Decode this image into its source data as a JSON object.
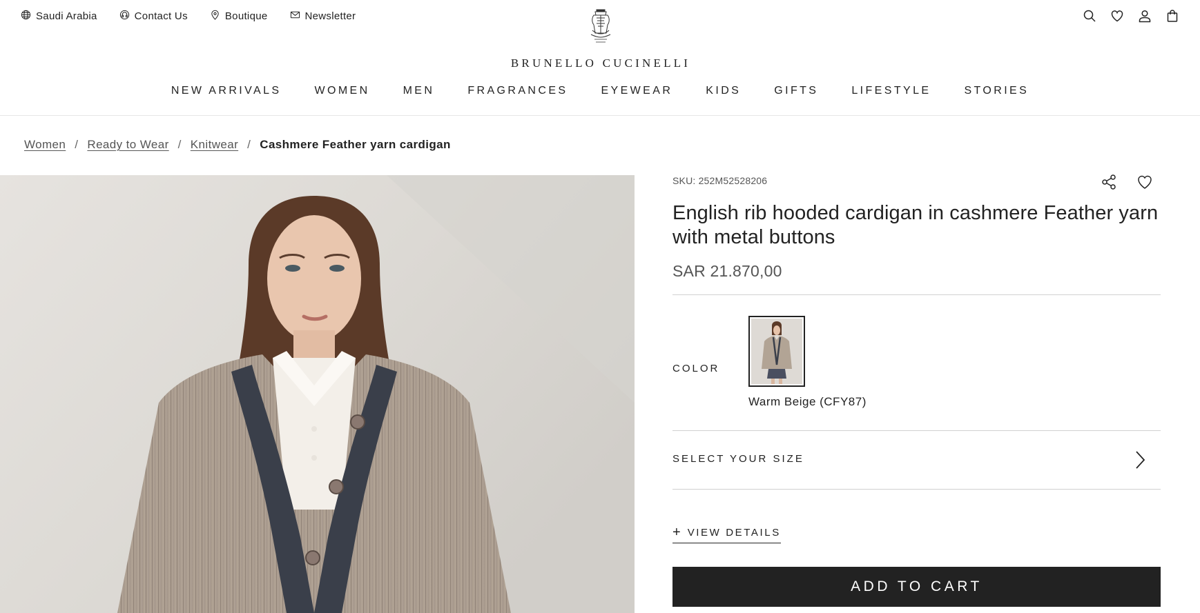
{
  "utility_nav": {
    "region": "Saudi Arabia",
    "contact": "Contact Us",
    "boutique": "Boutique",
    "newsletter": "Newsletter"
  },
  "brand": {
    "name": "BRUNELLO CUCINELLI"
  },
  "header_icons": [
    "search-icon",
    "heart-icon",
    "user-icon",
    "bag-icon"
  ],
  "main_nav": [
    "NEW ARRIVALS",
    "WOMEN",
    "MEN",
    "FRAGRANCES",
    "EYEWEAR",
    "KIDS",
    "GIFTS",
    "LIFESTYLE",
    "STORIES"
  ],
  "breadcrumb": {
    "items": [
      "Women",
      "Ready to Wear",
      "Knitwear"
    ],
    "separator": "/",
    "current": "Cashmere Feather yarn cardigan"
  },
  "product": {
    "sku": "SKU: 252M52528206",
    "title": "English rib hooded cardigan in cashmere Feather yarn with metal buttons",
    "price": "SAR 21.870,00",
    "color_label": "COLOR",
    "color_name": "Warm Beige (CFY87)",
    "size_label": "SELECT YOUR SIZE",
    "details_plus": "+",
    "details_label": "VIEW DETAILS",
    "add_to_cart": "ADD TO CART"
  },
  "colors": {
    "button_bg": "#222222",
    "text": "#222222",
    "muted": "#555555",
    "divider": "#d0d0d0"
  }
}
